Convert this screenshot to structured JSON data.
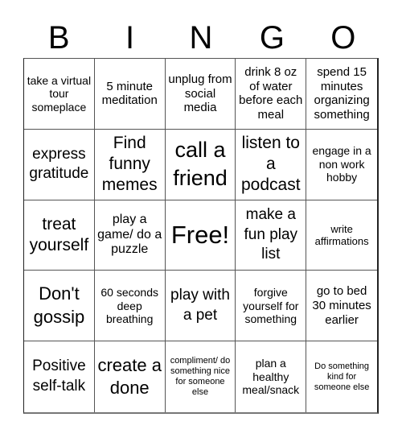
{
  "header": {
    "letters": [
      "B",
      "I",
      "N",
      "G",
      "O"
    ]
  },
  "card": {
    "rows": [
      [
        {
          "text": "take a virtual tour someplace"
        },
        {
          "text": "5 minute meditation"
        },
        {
          "text": "unplug from social media"
        },
        {
          "text": "drink 8 oz of water before each meal"
        },
        {
          "text": "spend 15 minutes organizing something"
        }
      ],
      [
        {
          "text": "express gratitude"
        },
        {
          "text": "Find funny memes"
        },
        {
          "text": "call a friend"
        },
        {
          "text": "listen to a podcast"
        },
        {
          "text": "engage in a non work hobby"
        }
      ],
      [
        {
          "text": "treat yourself"
        },
        {
          "text": "play a game/ do a puzzle"
        },
        {
          "text": "Free!",
          "free": true
        },
        {
          "text": "make a fun play list"
        },
        {
          "text": "write affirmations"
        }
      ],
      [
        {
          "text": "Don't gossip"
        },
        {
          "text": "60 seconds deep breathing"
        },
        {
          "text": "play with a pet"
        },
        {
          "text": "forgive yourself for something"
        },
        {
          "text": "go to bed 30 minutes earlier"
        }
      ],
      [
        {
          "text": "Positive self-talk"
        },
        {
          "text": "create a done"
        },
        {
          "text": "compliment/ do something nice for someone else"
        },
        {
          "text": "plan a healthy meal/snack"
        },
        {
          "text": "Do something kind for someone else"
        }
      ]
    ]
  }
}
